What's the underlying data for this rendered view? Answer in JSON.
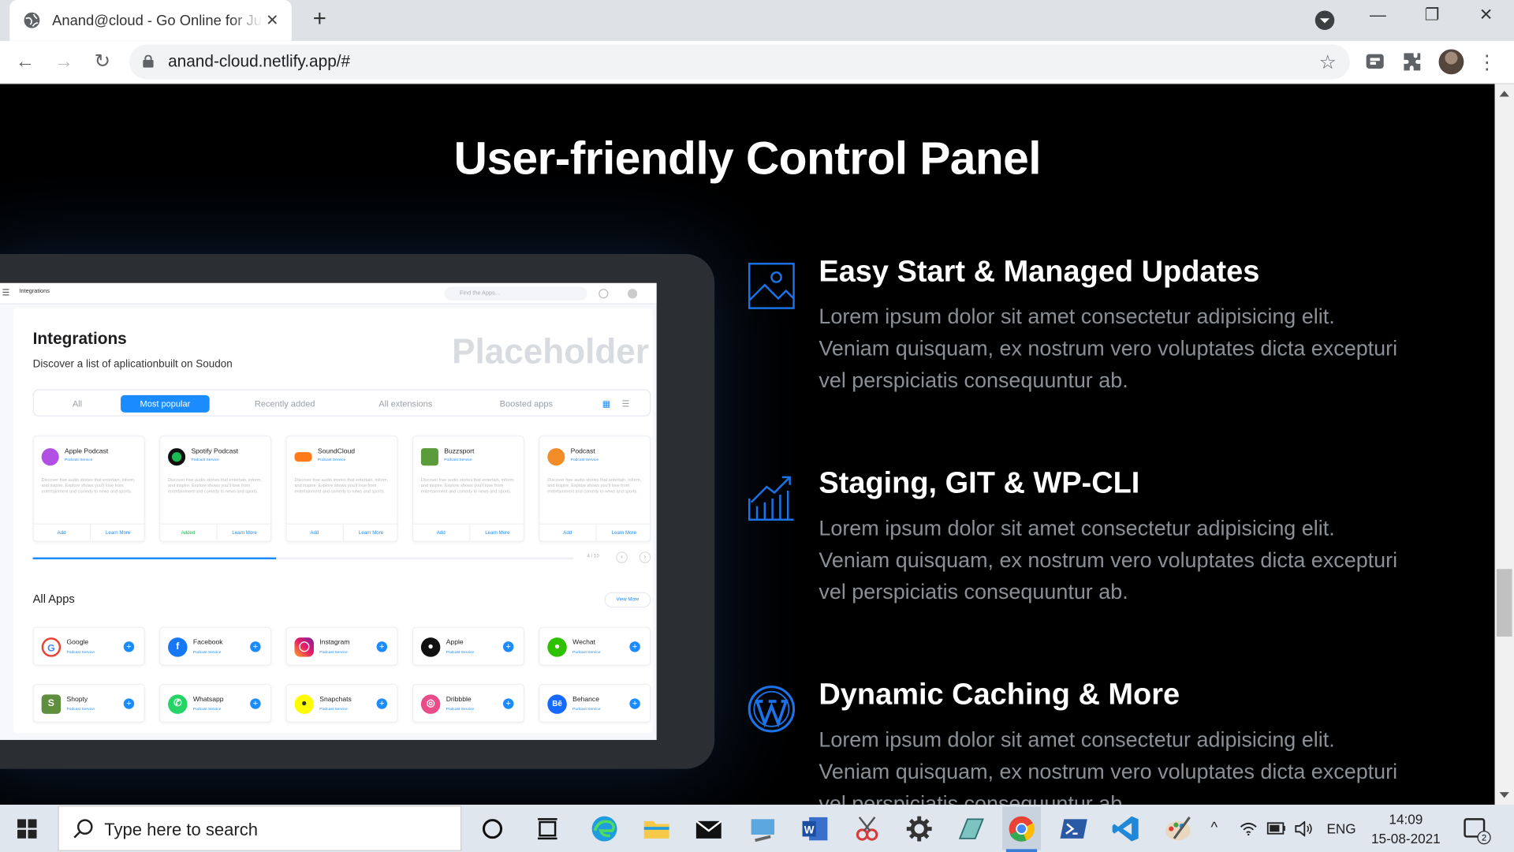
{
  "browser": {
    "tab_title": "Anand@cloud - Go Online for Just",
    "url": "anand-cloud.netlify.app/#",
    "new_tab": "+",
    "close_tab": "✕",
    "minimize": "—",
    "restore": "❐",
    "close": "✕"
  },
  "page": {
    "heading": "User-friendly Control Panel",
    "features": [
      {
        "title": "Easy Start & Managed Updates",
        "description": "Lorem ipsum dolor sit amet consectetur adipisicing elit. Veniam quisquam, ex nostrum vero voluptates dicta excepturi vel perspiciatis consequuntur ab.",
        "icon": "image-icon"
      },
      {
        "title": "Staging, GIT & WP-CLI",
        "description": "Lorem ipsum dolor sit amet consectetur adipisicing elit. Veniam quisquam, ex nostrum vero voluptates dicta excepturi vel perspiciatis consequuntur ab.",
        "icon": "chart-growth-icon"
      },
      {
        "title": "Dynamic Caching & More",
        "description": "Lorem ipsum dolor sit amet consectetur adipisicing elit. Veniam quisquam, ex nostrum vero voluptates dicta excepturi vel perspiciatis consequuntur ab.",
        "icon": "wordpress-icon"
      }
    ],
    "accent_color": "#1a73e8"
  },
  "screenshot": {
    "topbar_label": "Integrations",
    "search_placeholder": "Find the Apps...",
    "title": "Integrations",
    "subtitle": "Discover a list of aplicationbuilt on Soudon",
    "placeholder_text": "Placeholder",
    "filters": [
      "All",
      "Most popular",
      "Recently added",
      "All extensions",
      "Boosted apps"
    ],
    "cards": [
      {
        "name": "Apple Podcast",
        "type": "Podcast Service",
        "left": "Add",
        "right": "Learn More"
      },
      {
        "name": "Spotify Podcast",
        "type": "Podcast Service",
        "left": "Added",
        "right": "Learn More"
      },
      {
        "name": "SoundCloud",
        "type": "Podcast Service",
        "left": "Add",
        "right": "Learn More"
      },
      {
        "name": "Buzzsport",
        "type": "Podcast Service",
        "left": "Add",
        "right": "Learn More"
      },
      {
        "name": "Podcast",
        "type": "Podcast Service",
        "left": "Add",
        "right": "Learn More"
      }
    ],
    "card_description": "Discover free audio stories that entertain, inform, and inspire. Explore shows you'll love from entertainment and comedy to news and sports.",
    "progress": 0.45,
    "pager": "4 / 10",
    "all_apps": "All Apps",
    "view_more": "View More",
    "apps": [
      {
        "name": "Google",
        "type": "Podcast Service"
      },
      {
        "name": "Facebook",
        "type": "Podcast Service"
      },
      {
        "name": "Instagram",
        "type": "Podcast Service"
      },
      {
        "name": "Apple",
        "type": "Podcast Service"
      },
      {
        "name": "Wechat",
        "type": "Podcast Service"
      },
      {
        "name": "Shopty",
        "type": "Podcast Service"
      },
      {
        "name": "Whatsapp",
        "type": "Podcast Service"
      },
      {
        "name": "Snapchats",
        "type": "Podcast Service"
      },
      {
        "name": "Dribbble",
        "type": "Podcast Service"
      },
      {
        "name": "Behance",
        "type": "Podcast Service"
      }
    ]
  },
  "taskbar": {
    "search_placeholder": "Type here to search",
    "language": "ENG",
    "time": "14:09",
    "date": "15-08-2021",
    "notifications": "2"
  }
}
